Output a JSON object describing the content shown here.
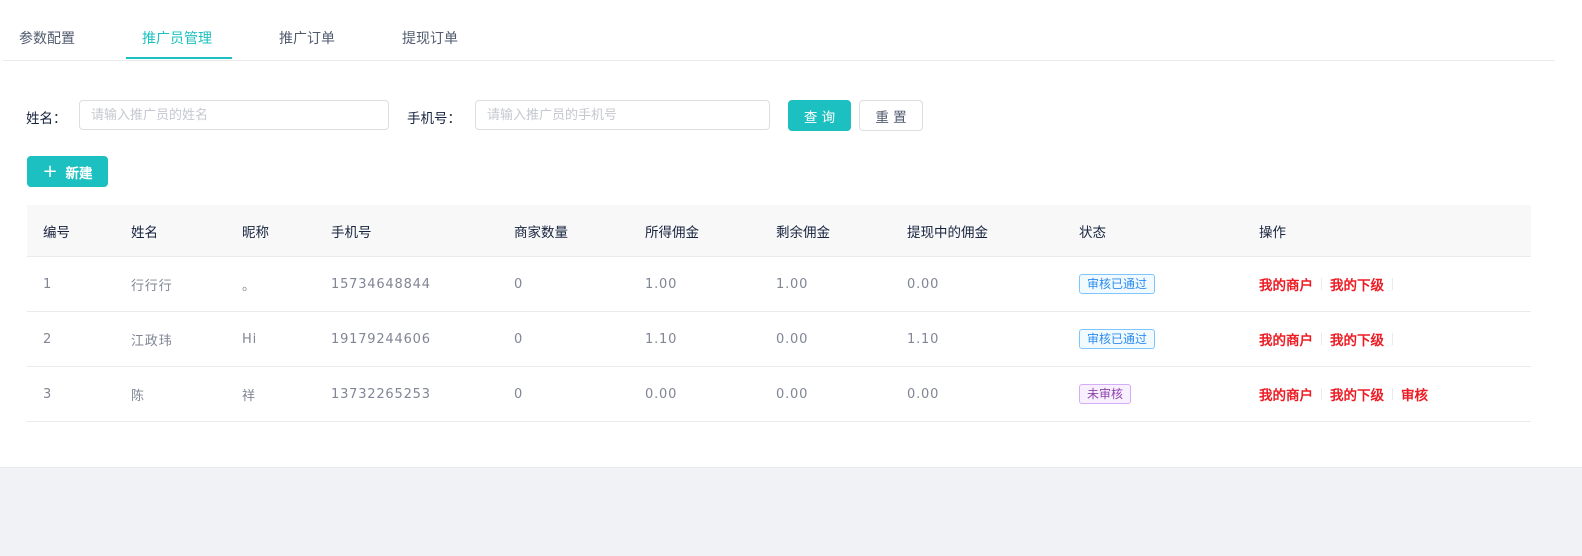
{
  "tabs": [
    {
      "label": "参数配置"
    },
    {
      "label": "推广员管理"
    },
    {
      "label": "推广订单"
    },
    {
      "label": "提现订单"
    }
  ],
  "search": {
    "name_label": "姓名：",
    "name_placeholder": "请输入推广员的姓名",
    "phone_label": "手机号：",
    "phone_placeholder": "请输入推广员的手机号",
    "query_label": "查 询",
    "reset_label": "重 置"
  },
  "toolbar": {
    "new_icon": "+",
    "new_label": "新建"
  },
  "table": {
    "headers": [
      "编号",
      "姓名",
      "昵称",
      "手机号",
      "商家数量",
      "所得佣金",
      "剩余佣金",
      "提现中的佣金",
      "状态",
      "操作"
    ],
    "rows": [
      {
        "id": "1",
        "name": "行行行",
        "nickname": "。",
        "phone": "15734648844",
        "merchants": "0",
        "earned": "1.00",
        "remaining": "1.00",
        "withdrawing": "0.00",
        "status": "审核已通过"
      },
      {
        "id": "2",
        "name": "江政玮",
        "nickname": "Hi",
        "phone": "19179244606",
        "merchants": "0",
        "earned": "1.10",
        "remaining": "0.00",
        "withdrawing": "1.10",
        "status": "审核已通过"
      },
      {
        "id": "3",
        "name": "陈",
        "nickname": "祥",
        "phone": "13732265253",
        "merchants": "0",
        "earned": "0.00",
        "remaining": "0.00",
        "withdrawing": "0.00",
        "status": "未审核"
      }
    ],
    "actions": {
      "merchants": "我的商户",
      "subordinates": "我的下级",
      "review": "审核"
    }
  },
  "colors": {
    "accent": "#1cc0c0",
    "action": "#ed1c24",
    "tag_pass": "#2d8cf0",
    "tag_pending": "#8e44ad"
  }
}
